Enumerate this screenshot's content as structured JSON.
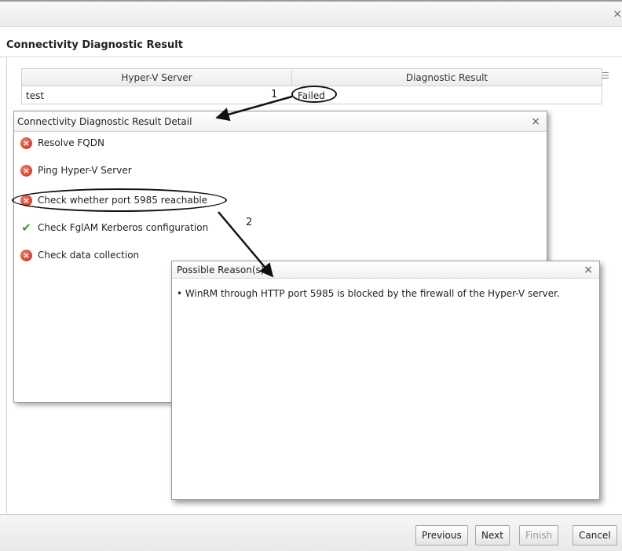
{
  "window": {
    "title": "Connectivity Diagnostic Result",
    "close_glyph": "×"
  },
  "table": {
    "columns": [
      "Hyper-V Server",
      "Diagnostic Result"
    ],
    "rows": [
      {
        "server": "test",
        "result": "Failed"
      }
    ]
  },
  "callouts": [
    "1",
    "2"
  ],
  "detail_dialog": {
    "title": "Connectivity Diagnostic Result Detail",
    "items": [
      {
        "label": "Resolve FQDN",
        "status": "failed"
      },
      {
        "label": "Ping Hyper-V Server",
        "status": "failed"
      },
      {
        "label": "Check whether port 5985 reachable",
        "status": "failed"
      },
      {
        "label": "Check FglAM Kerberos configuration",
        "status": "passed"
      },
      {
        "label": "Check data collection",
        "status": "failed"
      }
    ]
  },
  "reasons_dialog": {
    "title": "Possible Reason(s):",
    "reasons": [
      "• WinRM through HTTP port 5985 is blocked by the firewall of the Hyper-V server."
    ]
  },
  "footer": {
    "previous_label": "Previous",
    "next_label": "Next",
    "finish_label": "Finish",
    "cancel_label": "Cancel"
  },
  "icons": {
    "failed": "red-x-circle-icon",
    "passed": "green-check-icon"
  },
  "colors": {
    "failed": "#c42815",
    "passed": "#3a9a2a"
  }
}
